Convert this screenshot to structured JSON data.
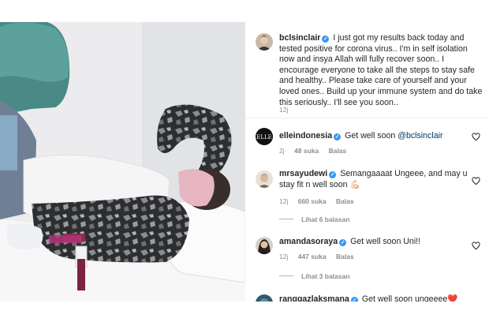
{
  "post": {
    "username": "bclsinclair",
    "caption": "I just got my results back today and tested positive for corona virus.. I'm in self isolation now and insya Allah will fully recover soon.. I encourage everyone to take all the steps to stay safe and healthy.. Please take care of yourself and your loved ones.. Build up your immune system and do take this seriously.. I'll see you soon..",
    "time": "12j",
    "verified_glyph": "✓"
  },
  "comments": [
    {
      "username": "elleindonesia",
      "text_prefix": "Get well soon ",
      "mention": "@bclsinclair",
      "time": "2j",
      "likes": "48 suka",
      "reply": "Balas",
      "avatar_text": "ELLE"
    },
    {
      "username": "mrsayudewi",
      "text": "Semangaaaat Ungeee, and may u stay fit n well soon 💪🏻",
      "time": "12j",
      "likes": "660 suka",
      "reply": "Balas",
      "view_replies": "Lihat 6 balasan"
    },
    {
      "username": "amandasoraya",
      "text": "Get well soon Uni!!",
      "time": "12j",
      "likes": "447 suka",
      "reply": "Balas",
      "view_replies": "Lihat 3 balasan"
    },
    {
      "username": "ranggazlaksmana",
      "text": "Get well soon ungeeee❤️"
    }
  ],
  "colors": {
    "verified": "#3897f0",
    "meta": "#8e8e8e",
    "mention": "#00376b"
  }
}
